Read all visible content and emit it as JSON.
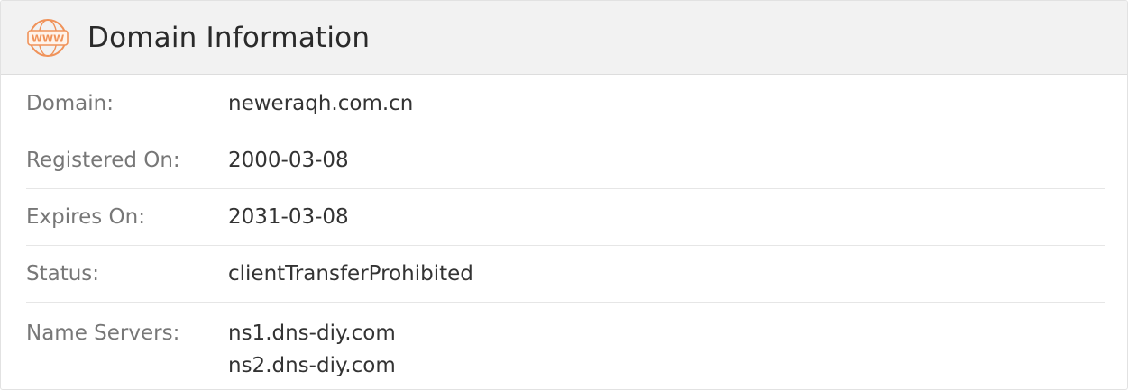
{
  "header": {
    "title": "Domain Information",
    "icon": "www-icon",
    "icon_text": "WWW",
    "accent": "#f0935a"
  },
  "rows": [
    {
      "label": "Domain:",
      "value": "neweraqh.com.cn"
    },
    {
      "label": "Registered On:",
      "value": "2000-03-08"
    },
    {
      "label": "Expires On:",
      "value": "2031-03-08"
    },
    {
      "label": "Status:",
      "value": "clientTransferProhibited"
    }
  ],
  "name_servers": {
    "label": "Name Servers:",
    "values": [
      "ns1.dns-diy.com",
      "ns2.dns-diy.com"
    ]
  }
}
